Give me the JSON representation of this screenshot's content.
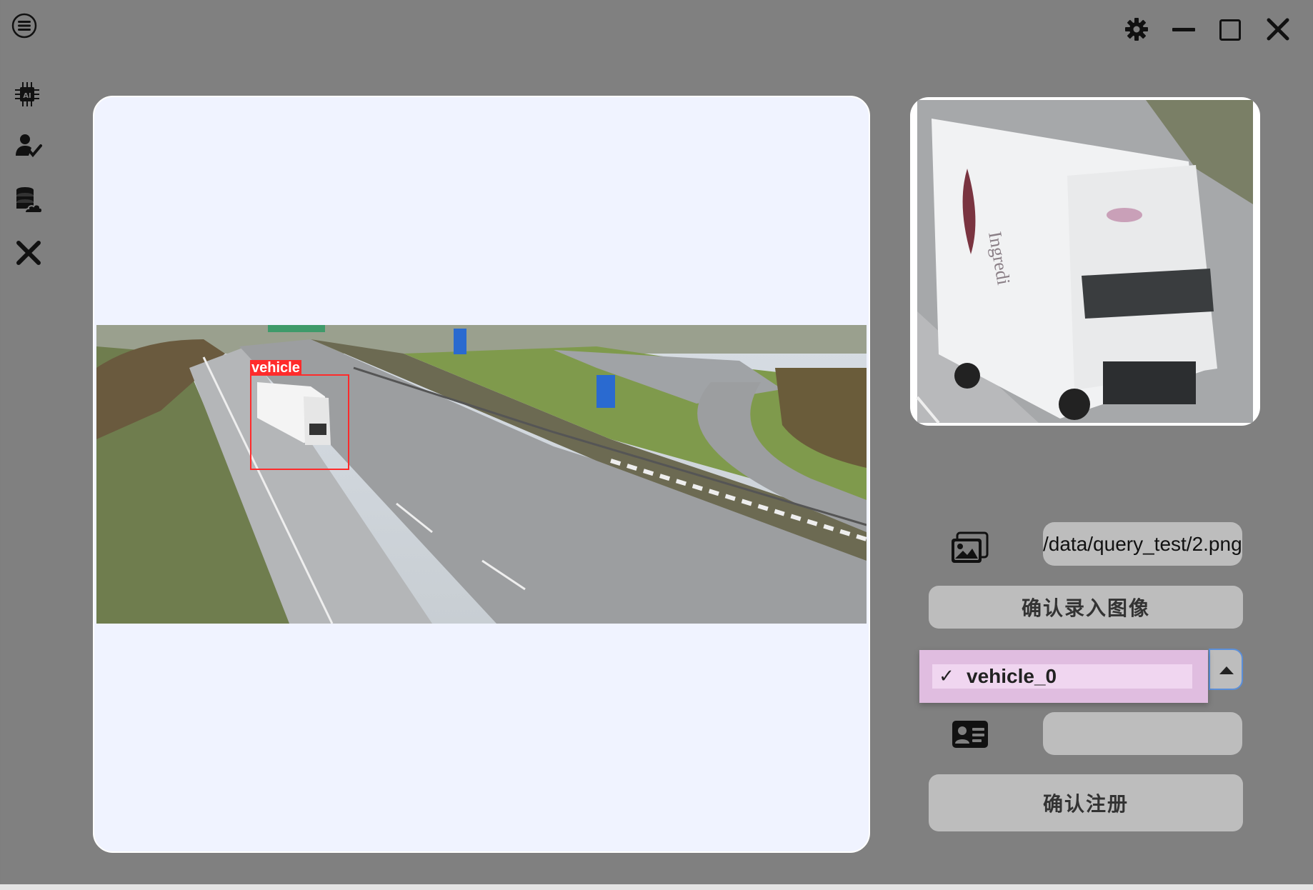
{
  "window": {
    "menu_icon": "hamburger-menu-icon",
    "controls": [
      "settings-gear-icon",
      "minimize-icon",
      "maximize-icon",
      "close-icon"
    ]
  },
  "sidebar": {
    "items": [
      {
        "name": "ai-chip-icon"
      },
      {
        "name": "user-check-icon"
      },
      {
        "name": "database-cloud-icon"
      },
      {
        "name": "exit-x-icon"
      }
    ]
  },
  "detection": {
    "label": "vehicle",
    "box_color": "#ff2b2b"
  },
  "form": {
    "image_path": "/data/query_test/2.png",
    "confirm_image_button": "确认录入图像",
    "dropdown": {
      "selected": "vehicle_0",
      "check": "✓"
    },
    "id_value": "",
    "register_button": "确认注册"
  },
  "colors": {
    "background": "#808080",
    "panel": "#f0f3ff",
    "button": "#bdbdbd",
    "dropdown_highlight": "#e0bde0",
    "focus_border": "#5b8fd9"
  }
}
